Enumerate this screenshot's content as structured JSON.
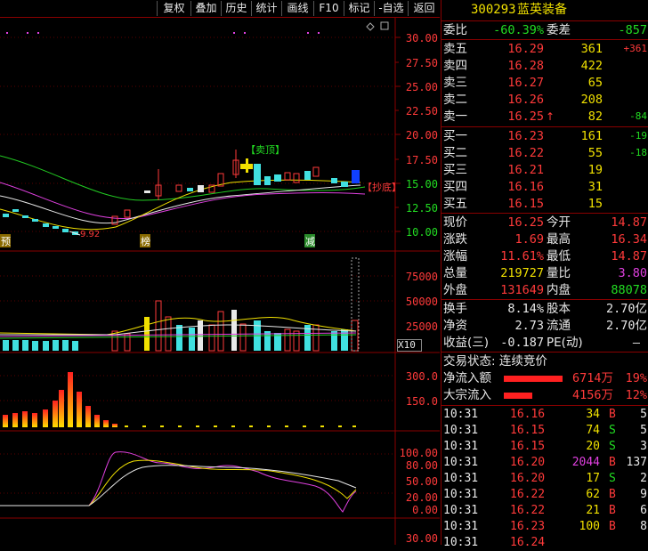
{
  "toolbar": {
    "buttons": [
      "复权",
      "叠加",
      "历史",
      "统计",
      "画线",
      "F10",
      "标记",
      "-自选",
      "返回"
    ]
  },
  "chart": {
    "price_axis": [
      "30.00",
      "27.50",
      "25.00",
      "22.50",
      "20.00",
      "17.50",
      "15.00",
      "12.50",
      "10.00"
    ],
    "volume_axis": [
      "75000",
      "50000",
      "25000"
    ],
    "volume_unit": "X10",
    "indicator1_axis": [
      "300.0",
      "150.0"
    ],
    "indicator2_axis": [
      "100.00",
      "80.00",
      "50.00",
      "20.00",
      "0.00"
    ],
    "bottom_axis": "30.00",
    "annotation_sell": "【卖顶】",
    "annotation_buy": "【抄底】",
    "low_label": "9.92",
    "markers": [
      "预",
      "榜",
      "减"
    ]
  },
  "quote": {
    "code": "300293",
    "name": "蓝英装备",
    "weibi_label": "委比",
    "weibi_value": "-60.39%",
    "weicha_label": "委差",
    "weicha_value": "-857",
    "asks": [
      {
        "label": "卖五",
        "price": "16.29",
        "vol": "361",
        "chg": "+361"
      },
      {
        "label": "卖四",
        "price": "16.28",
        "vol": "422",
        "chg": ""
      },
      {
        "label": "卖三",
        "price": "16.27",
        "vol": "65",
        "chg": ""
      },
      {
        "label": "卖二",
        "price": "16.26",
        "vol": "208",
        "chg": ""
      },
      {
        "label": "卖一",
        "price": "16.25",
        "vol": "82",
        "chg": "-84"
      }
    ],
    "ask1_arrow": "↑",
    "bids": [
      {
        "label": "买一",
        "price": "16.23",
        "vol": "161",
        "chg": "-19"
      },
      {
        "label": "买二",
        "price": "16.22",
        "vol": "55",
        "chg": "-18"
      },
      {
        "label": "买三",
        "price": "16.21",
        "vol": "19",
        "chg": ""
      },
      {
        "label": "买四",
        "price": "16.16",
        "vol": "31",
        "chg": ""
      },
      {
        "label": "买五",
        "price": "16.15",
        "vol": "15",
        "chg": ""
      }
    ],
    "stats": [
      {
        "l1": "现价",
        "v1": "16.25",
        "l2": "今开",
        "v2": "14.87"
      },
      {
        "l1": "涨跌",
        "v1": "1.69",
        "l2": "最高",
        "v2": "16.34"
      },
      {
        "l1": "涨幅",
        "v1": "11.61%",
        "l2": "最低",
        "v2": "14.87"
      },
      {
        "l1": "总量",
        "v1": "219727",
        "l2": "量比",
        "v2": "3.80"
      },
      {
        "l1": "外盘",
        "v1": "131649",
        "l2": "内盘",
        "v2": "88078"
      }
    ],
    "stats2": [
      {
        "l1": "换手",
        "v1": "8.14%",
        "l2": "股本",
        "v2": "2.70亿"
      },
      {
        "l1": "净资",
        "v1": "2.73",
        "l2": "流通",
        "v2": "2.70亿"
      },
      {
        "l1": "收益(三)",
        "v1": "-0.187",
        "l2": "PE(动)",
        "v2": "—"
      }
    ],
    "trade_status": "交易状态: 连续竞价",
    "netflow_label": "净流入额",
    "netflow_value": "6714万",
    "netflow_pct": "19%",
    "bigflow_label": "大宗流入",
    "bigflow_value": "4156万",
    "bigflow_pct": "12%",
    "ticks": [
      {
        "t": "10:31",
        "p": "16.16",
        "v": "34",
        "s": "B",
        "n": "5"
      },
      {
        "t": "10:31",
        "p": "16.15",
        "v": "74",
        "s": "S",
        "n": "5"
      },
      {
        "t": "10:31",
        "p": "16.15",
        "v": "20",
        "s": "S",
        "n": "3"
      },
      {
        "t": "10:31",
        "p": "16.20",
        "v": "2044",
        "s": "B",
        "n": "137"
      },
      {
        "t": "10:31",
        "p": "16.20",
        "v": "17",
        "s": "S",
        "n": "2"
      },
      {
        "t": "10:31",
        "p": "16.22",
        "v": "62",
        "s": "B",
        "n": "9"
      },
      {
        "t": "10:31",
        "p": "16.22",
        "v": "21",
        "s": "B",
        "n": "6"
      },
      {
        "t": "10:31",
        "p": "16.23",
        "v": "100",
        "s": "B",
        "n": "8"
      },
      {
        "t": "10:31",
        "p": "16.24",
        "v": "",
        "s": "",
        "n": ""
      }
    ]
  }
}
